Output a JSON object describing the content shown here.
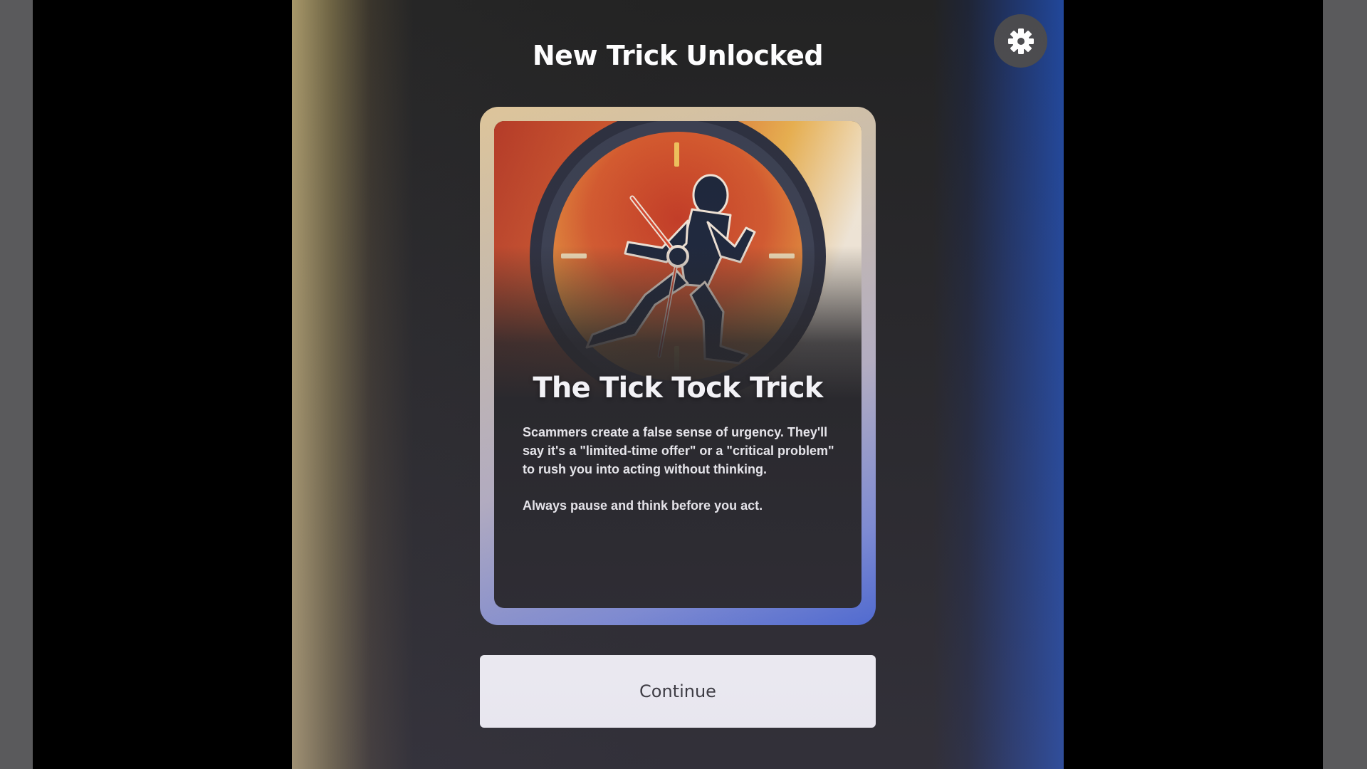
{
  "header": {
    "title": "New Trick Unlocked"
  },
  "settings": {
    "icon": "gear-icon"
  },
  "card": {
    "title": "The Tick Tock Trick",
    "paragraphs": [
      "Scammers create a false sense of urgency. They'll say it's a \"limited-time offer\" or a \"critical problem\" to rush you into acting without thinking.",
      "Always pause and think before you act."
    ],
    "illustration": "clock-running-man-illustration"
  },
  "actions": {
    "continue_label": "Continue"
  },
  "colors": {
    "background": "#232323",
    "card": "#222222",
    "button": "#ffffff",
    "accent_blue": "#21479a",
    "accent_gold": "#a8986a"
  }
}
